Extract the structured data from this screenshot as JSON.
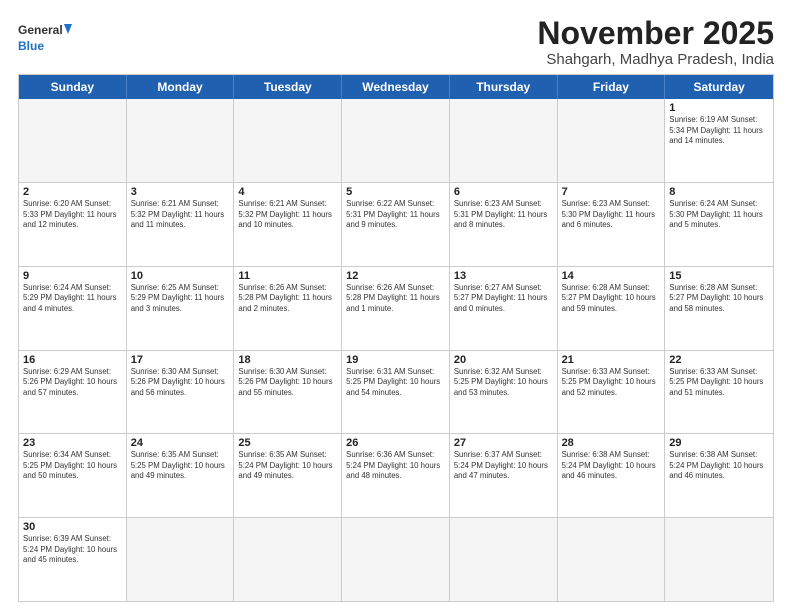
{
  "header": {
    "logo_general": "General",
    "logo_blue": "Blue",
    "month_title": "November 2025",
    "subtitle": "Shahgarh, Madhya Pradesh, India"
  },
  "days_of_week": [
    "Sunday",
    "Monday",
    "Tuesday",
    "Wednesday",
    "Thursday",
    "Friday",
    "Saturday"
  ],
  "weeks": [
    [
      {
        "day": "",
        "info": ""
      },
      {
        "day": "",
        "info": ""
      },
      {
        "day": "",
        "info": ""
      },
      {
        "day": "",
        "info": ""
      },
      {
        "day": "",
        "info": ""
      },
      {
        "day": "",
        "info": ""
      },
      {
        "day": "1",
        "info": "Sunrise: 6:19 AM\nSunset: 5:34 PM\nDaylight: 11 hours and 14 minutes."
      }
    ],
    [
      {
        "day": "2",
        "info": "Sunrise: 6:20 AM\nSunset: 5:33 PM\nDaylight: 11 hours and 12 minutes."
      },
      {
        "day": "3",
        "info": "Sunrise: 6:21 AM\nSunset: 5:32 PM\nDaylight: 11 hours and 11 minutes."
      },
      {
        "day": "4",
        "info": "Sunrise: 6:21 AM\nSunset: 5:32 PM\nDaylight: 11 hours and 10 minutes."
      },
      {
        "day": "5",
        "info": "Sunrise: 6:22 AM\nSunset: 5:31 PM\nDaylight: 11 hours and 9 minutes."
      },
      {
        "day": "6",
        "info": "Sunrise: 6:23 AM\nSunset: 5:31 PM\nDaylight: 11 hours and 8 minutes."
      },
      {
        "day": "7",
        "info": "Sunrise: 6:23 AM\nSunset: 5:30 PM\nDaylight: 11 hours and 6 minutes."
      },
      {
        "day": "8",
        "info": "Sunrise: 6:24 AM\nSunset: 5:30 PM\nDaylight: 11 hours and 5 minutes."
      }
    ],
    [
      {
        "day": "9",
        "info": "Sunrise: 6:24 AM\nSunset: 5:29 PM\nDaylight: 11 hours and 4 minutes."
      },
      {
        "day": "10",
        "info": "Sunrise: 6:25 AM\nSunset: 5:29 PM\nDaylight: 11 hours and 3 minutes."
      },
      {
        "day": "11",
        "info": "Sunrise: 6:26 AM\nSunset: 5:28 PM\nDaylight: 11 hours and 2 minutes."
      },
      {
        "day": "12",
        "info": "Sunrise: 6:26 AM\nSunset: 5:28 PM\nDaylight: 11 hours and 1 minute."
      },
      {
        "day": "13",
        "info": "Sunrise: 6:27 AM\nSunset: 5:27 PM\nDaylight: 11 hours and 0 minutes."
      },
      {
        "day": "14",
        "info": "Sunrise: 6:28 AM\nSunset: 5:27 PM\nDaylight: 10 hours and 59 minutes."
      },
      {
        "day": "15",
        "info": "Sunrise: 6:28 AM\nSunset: 5:27 PM\nDaylight: 10 hours and 58 minutes."
      }
    ],
    [
      {
        "day": "16",
        "info": "Sunrise: 6:29 AM\nSunset: 5:26 PM\nDaylight: 10 hours and 57 minutes."
      },
      {
        "day": "17",
        "info": "Sunrise: 6:30 AM\nSunset: 5:26 PM\nDaylight: 10 hours and 56 minutes."
      },
      {
        "day": "18",
        "info": "Sunrise: 6:30 AM\nSunset: 5:26 PM\nDaylight: 10 hours and 55 minutes."
      },
      {
        "day": "19",
        "info": "Sunrise: 6:31 AM\nSunset: 5:25 PM\nDaylight: 10 hours and 54 minutes."
      },
      {
        "day": "20",
        "info": "Sunrise: 6:32 AM\nSunset: 5:25 PM\nDaylight: 10 hours and 53 minutes."
      },
      {
        "day": "21",
        "info": "Sunrise: 6:33 AM\nSunset: 5:25 PM\nDaylight: 10 hours and 52 minutes."
      },
      {
        "day": "22",
        "info": "Sunrise: 6:33 AM\nSunset: 5:25 PM\nDaylight: 10 hours and 51 minutes."
      }
    ],
    [
      {
        "day": "23",
        "info": "Sunrise: 6:34 AM\nSunset: 5:25 PM\nDaylight: 10 hours and 50 minutes."
      },
      {
        "day": "24",
        "info": "Sunrise: 6:35 AM\nSunset: 5:25 PM\nDaylight: 10 hours and 49 minutes."
      },
      {
        "day": "25",
        "info": "Sunrise: 6:35 AM\nSunset: 5:24 PM\nDaylight: 10 hours and 49 minutes."
      },
      {
        "day": "26",
        "info": "Sunrise: 6:36 AM\nSunset: 5:24 PM\nDaylight: 10 hours and 48 minutes."
      },
      {
        "day": "27",
        "info": "Sunrise: 6:37 AM\nSunset: 5:24 PM\nDaylight: 10 hours and 47 minutes."
      },
      {
        "day": "28",
        "info": "Sunrise: 6:38 AM\nSunset: 5:24 PM\nDaylight: 10 hours and 46 minutes."
      },
      {
        "day": "29",
        "info": "Sunrise: 6:38 AM\nSunset: 5:24 PM\nDaylight: 10 hours and 46 minutes."
      }
    ],
    [
      {
        "day": "30",
        "info": "Sunrise: 6:39 AM\nSunset: 5:24 PM\nDaylight: 10 hours and 45 minutes."
      },
      {
        "day": "",
        "info": ""
      },
      {
        "day": "",
        "info": ""
      },
      {
        "day": "",
        "info": ""
      },
      {
        "day": "",
        "info": ""
      },
      {
        "day": "",
        "info": ""
      },
      {
        "day": "",
        "info": ""
      }
    ]
  ]
}
